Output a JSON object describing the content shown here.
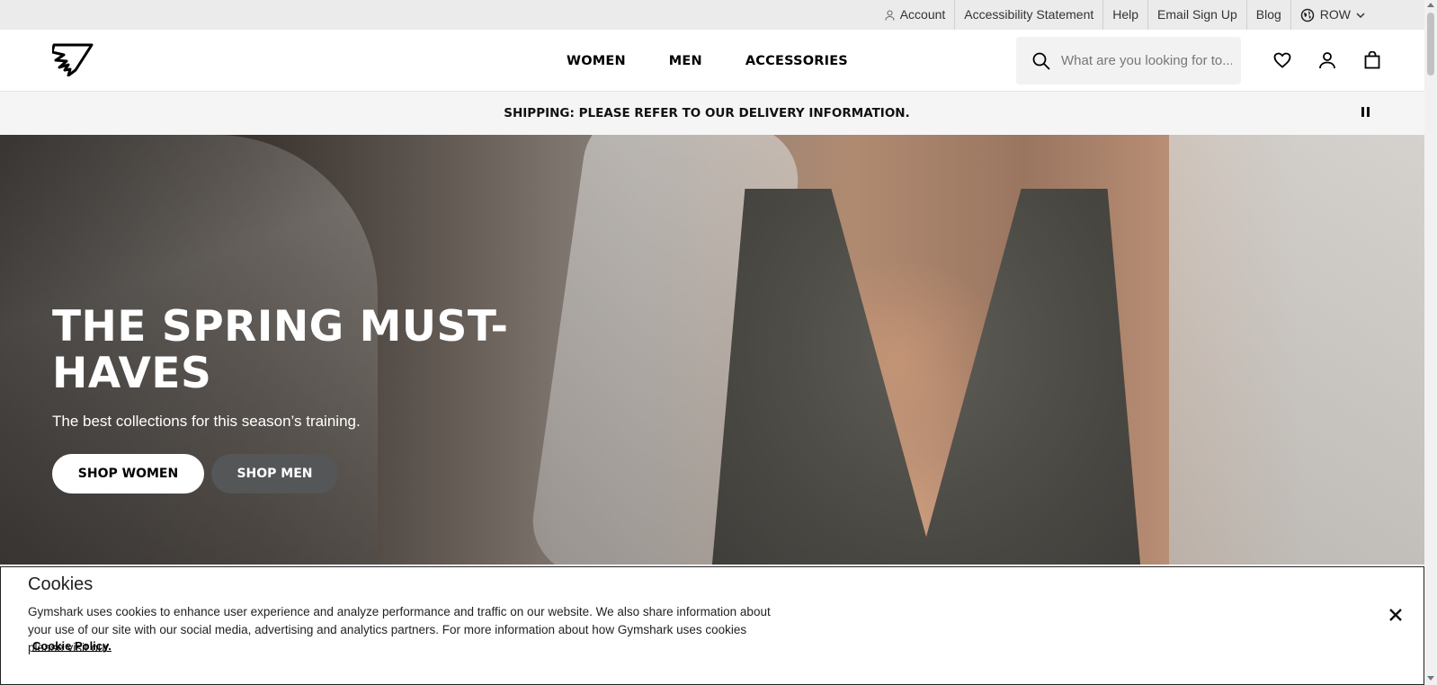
{
  "utility_bar": {
    "items": [
      {
        "label": "Account",
        "icon": "account-icon"
      },
      {
        "label": "Accessibility Statement"
      },
      {
        "label": "Help"
      },
      {
        "label": "Email Sign Up"
      },
      {
        "label": "Blog"
      },
      {
        "label": "ROW",
        "icon": "globe-icon",
        "trailing_icon": "chevron-down-icon"
      }
    ]
  },
  "header": {
    "logo": "gymshark-logo",
    "nav": [
      {
        "label": "WOMEN"
      },
      {
        "label": "MEN"
      },
      {
        "label": "ACCESSORIES"
      }
    ],
    "search": {
      "placeholder": "What are you looking for to...",
      "icon": "search-icon"
    },
    "icons": [
      "heart-icon",
      "user-icon",
      "bag-icon"
    ]
  },
  "banner": {
    "text": "SHIPPING: PLEASE REFER TO OUR DELIVERY INFORMATION.",
    "control_icon": "pause-icon"
  },
  "hero": {
    "title": "THE SPRING MUST-HAVES",
    "subtitle": "The best collections for this season’s training.",
    "buttons": [
      {
        "label": "SHOP WOMEN"
      },
      {
        "label": "SHOP MEN"
      }
    ]
  },
  "cookie_panel": {
    "title": "Cookies",
    "text": "Gymshark uses cookies to enhance user experience and analyze performance and traffic on our website. We also share information about your use of our site with our social media, advertising and analytics partners. For more information about how Gymshark uses cookies please visit our",
    "link": "Cookie Policy.",
    "close_icon": "close-icon"
  },
  "colors": {
    "utility_bg": "#ebebeb",
    "banner_bg": "#f5f5f5",
    "search_bg": "#f2f2f2",
    "btn_secondary": "#545657"
  }
}
